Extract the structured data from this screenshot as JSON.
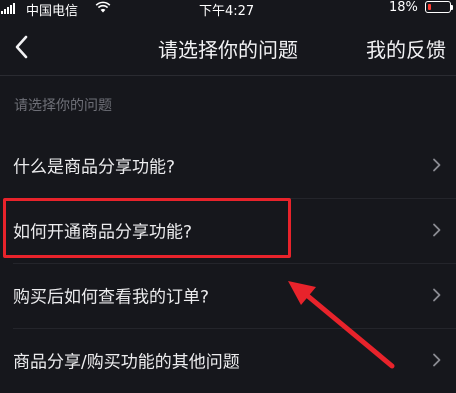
{
  "status_bar": {
    "carrier": "中国电信",
    "time": "下午4:27",
    "battery": "18%",
    "battery_level": 0.18
  },
  "nav": {
    "title": "请选择你的问题",
    "right_label": "我的反馈",
    "back_icon": "chevron-left-icon"
  },
  "section": {
    "header": "请选择你的问题"
  },
  "items": [
    {
      "label": "什么是商品分享功能?"
    },
    {
      "label": "如何开通商品分享功能?"
    },
    {
      "label": "购买后如何查看我的订单?"
    },
    {
      "label": "商品分享/购买功能的其他问题"
    }
  ],
  "colors": {
    "background": "#16171c",
    "highlight": "#e8232b",
    "battery_low": "#ff3b30"
  }
}
